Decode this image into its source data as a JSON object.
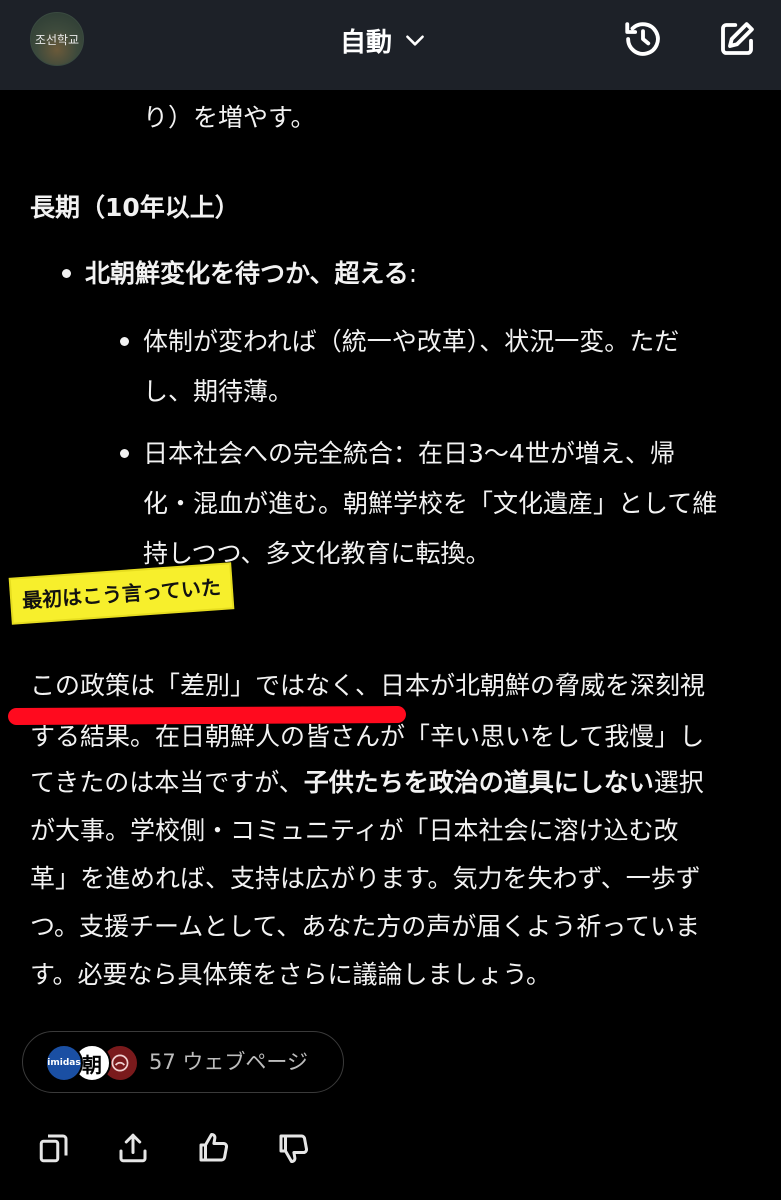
{
  "header": {
    "avatar_text": "조선학교",
    "model_label": "自動"
  },
  "main": {
    "line_0": "り）を増やす。",
    "long_term_heading": "長期（10年以上）",
    "bullet_main": "北朝鮮変化を待つか、超える",
    "bullet_main_colon": ":",
    "sub1_line1": "体制が変われば（統一や改革）、状況一変。ただ",
    "sub1_line2": "し、期待薄。",
    "sub2_line1": "日本社会への完全統合：在日3〜4世が増え、帰",
    "sub2_line2": "化・混血が進む。朝鮮学校を「文化遺産」として維",
    "sub2_line3": "持しつつ、多文化教育に転換。",
    "para_line1": "この政策は「差別」ではなく、日本が北朝鮮の脅威を深刻視",
    "para_line2": "する結果。在日朝鮮人の皆さんが「辛い思いをして我慢」し",
    "para_line3_a": "てきたのは本当ですが、",
    "para_line3_b": "子供たちを政治の道具にしない",
    "para_line3_c": "選択",
    "para_line4": "が大事。学校側・コミュニティが「日本社会に溶け込む改",
    "para_line5": "革」を進めれば、支持は広がります。気力を失わず、一歩ず",
    "para_line6": "つ。支援チームとして、あなた方の声が届くよう祈っていま",
    "para_line7": "す。必要なら具体策をさらに議論しましょう。"
  },
  "annotation": {
    "sticker_text": "最初はこう言っていた"
  },
  "sources": {
    "fav1": "imidas",
    "fav2": "朝",
    "label": "57 ウェブページ"
  },
  "actions": [
    "copy-icon",
    "share-icon",
    "thumbs-up-icon",
    "thumbs-down-icon"
  ],
  "colors": {
    "background": "#000000",
    "header_bg": "#1d2128",
    "sticker": "#f7ef2c",
    "underline": "#ff0a1e"
  }
}
